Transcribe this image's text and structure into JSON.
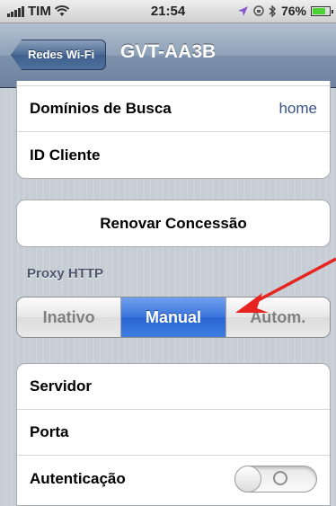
{
  "status_bar": {
    "carrier": "TIM",
    "time": "21:54",
    "battery_percent": "76%",
    "battery_level": 0.76
  },
  "nav": {
    "back_label": "Redes Wi-Fi",
    "title": "GVT-AA3B"
  },
  "dns_group": {
    "rows": [
      {
        "label": "Domínios de Busca",
        "value": "home"
      },
      {
        "label": "ID Cliente",
        "value": ""
      }
    ]
  },
  "renew_button": {
    "label": "Renovar Concessão"
  },
  "proxy": {
    "header": "Proxy HTTP",
    "options": [
      "Inativo",
      "Manual",
      "Autom."
    ],
    "selected": "Manual"
  },
  "proxy_group": {
    "rows": [
      {
        "label": "Servidor"
      },
      {
        "label": "Porta"
      },
      {
        "label": "Autenticação",
        "toggle": false
      }
    ]
  },
  "colors": {
    "accent": "#2764d2",
    "nav": "#6d83a0",
    "annotation_arrow": "#e8221e",
    "value_text": "#385487"
  }
}
